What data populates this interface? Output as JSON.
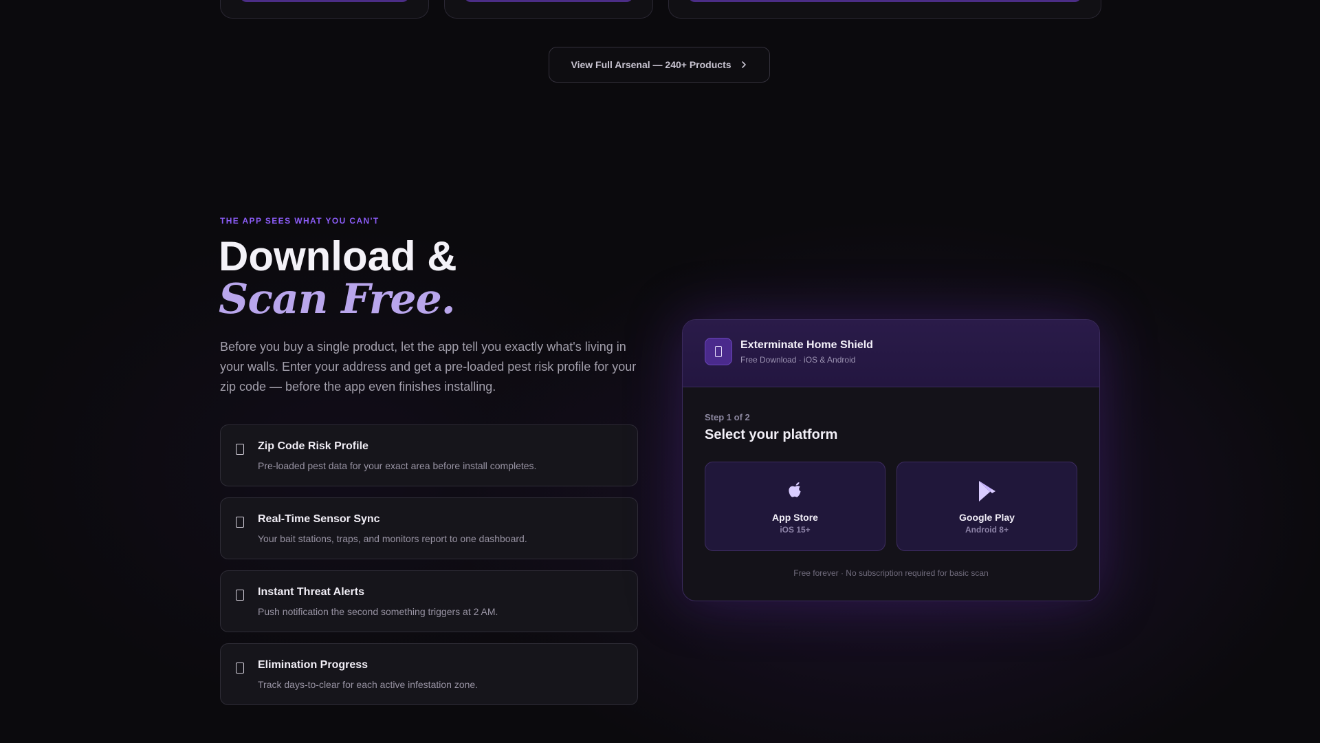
{
  "top_cta": {
    "label": "View Full Arsenal — 240+ Products"
  },
  "section": {
    "eyebrow": "THE APP SEES WHAT YOU CAN'T",
    "headline_line1": "Download &",
    "headline_line2": "Scan Free.",
    "lead": "Before you buy a single product, let the app tell you exactly what's living in your walls. Enter your address and get a pre-loaded pest risk profile for your zip code — before the app even finishes installing."
  },
  "features": [
    {
      "title": "Zip Code Risk Profile",
      "desc": "Pre-loaded pest data for your exact area before install completes."
    },
    {
      "title": "Real-Time Sensor Sync",
      "desc": "Your bait stations, traps, and monitors report to one dashboard."
    },
    {
      "title": "Instant Threat Alerts",
      "desc": "Push notification the second something triggers at 2 AM."
    },
    {
      "title": "Elimination Progress",
      "desc": "Track days-to-clear for each active infestation zone."
    }
  ],
  "app_card": {
    "name": "Exterminate Home Shield",
    "sub": "Free Download · iOS & Android",
    "step": "Step 1 of 2",
    "title": "Select your platform",
    "platforms": [
      {
        "name": "App Store",
        "version": "iOS 15+",
        "icon": "apple-icon"
      },
      {
        "name": "Google Play",
        "version": "Android 8+",
        "icon": "play-icon"
      }
    ],
    "footnote": "Free forever · No subscription required for basic scan"
  },
  "colors": {
    "background": "#0b0a0d",
    "accent": "#8b5cf6",
    "accent_soft": "#b9a6ec",
    "card_header": "#2a1b49"
  }
}
